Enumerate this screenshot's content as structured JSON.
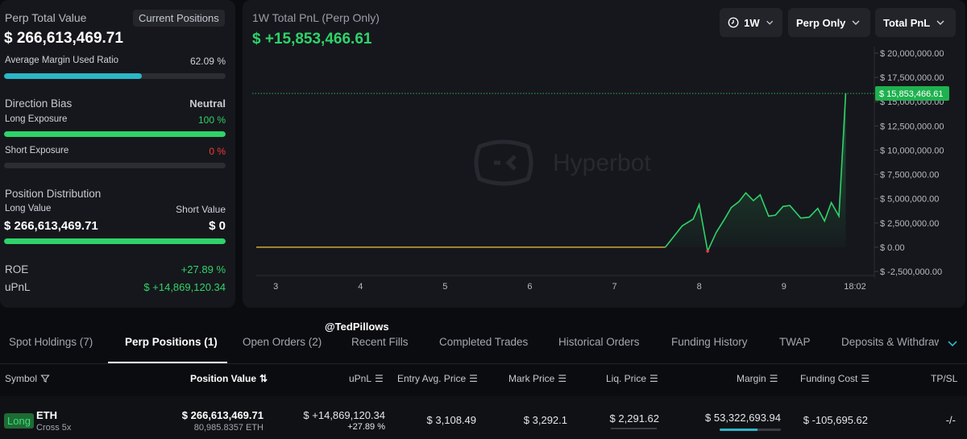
{
  "overview": {
    "title": "Perp Total Value",
    "current_positions_label": "Current Positions",
    "total_value": "$ 266,613,469.71",
    "avg_margin_label": "Average Margin Used Ratio",
    "avg_margin_value": "62.09 %",
    "avg_margin_fraction": 0.6209,
    "direction_bias_label": "Direction Bias",
    "direction_bias_value": "Neutral",
    "long_exposure_label": "Long Exposure",
    "long_exposure_value": "100 %",
    "long_exposure_fraction": 1.0,
    "short_exposure_label": "Short Exposure",
    "short_exposure_value": "0 %",
    "short_exposure_fraction": 0.0,
    "position_distribution_label": "Position Distribution",
    "long_value_label": "Long Value",
    "short_value_label": "Short Value",
    "long_value": "$ 266,613,469.71",
    "short_value": "$ 0",
    "long_distribution_fraction": 1.0,
    "roe_label": "ROE",
    "roe_value": "+27.89 %",
    "upnl_label": "uPnL",
    "upnl_value": "$ +14,869,120.34"
  },
  "chart_panel": {
    "title": "1W Total PnL (Perp Only)",
    "total_pnl": "$ +15,853,466.61",
    "timeframe": "1W",
    "scope": "Perp Only",
    "metric": "Total PnL",
    "watermark": "Hyperbot",
    "current_value_label": "$ 15,853,466.61"
  },
  "chart_data": {
    "type": "area",
    "y_ticks": [
      {
        "value": 20000000,
        "label": "$ 20,000,000.00"
      },
      {
        "value": 17500000,
        "label": "$ 17,500,000.00"
      },
      {
        "value": 15000000,
        "label": "$ 15,000,000.00"
      },
      {
        "value": 12500000,
        "label": "$ 12,500,000.00"
      },
      {
        "value": 10000000,
        "label": "$ 10,000,000.00"
      },
      {
        "value": 7500000,
        "label": "$ 7,500,000.00"
      },
      {
        "value": 5000000,
        "label": "$ 5,000,000.00"
      },
      {
        "value": 2500000,
        "label": "$ 2,500,000.00"
      },
      {
        "value": 0,
        "label": "$ 0.00"
      },
      {
        "value": -2500000,
        "label": "$ -2,500,000.00"
      }
    ],
    "ylim": [
      -2500000,
      20000000
    ],
    "x_ticks": [
      {
        "value": 3,
        "label": "3"
      },
      {
        "value": 4,
        "label": "4"
      },
      {
        "value": 5,
        "label": "5"
      },
      {
        "value": 6,
        "label": "6"
      },
      {
        "value": 7,
        "label": "7"
      },
      {
        "value": 8,
        "label": "8"
      },
      {
        "value": 9,
        "label": "9"
      },
      {
        "value": 9.84,
        "label": "18:02"
      }
    ],
    "xlim": [
      2.77,
      10.03
    ],
    "series": [
      {
        "x": [
          2.77,
          3.0,
          4.0,
          5.0,
          6.0,
          7.0,
          7.6,
          7.8,
          7.93,
          8.0,
          8.1,
          8.2,
          8.3,
          8.38,
          8.47,
          8.55,
          8.64,
          8.72,
          8.82,
          8.9,
          8.99,
          9.07,
          9.2,
          9.3,
          9.4,
          9.48,
          9.56,
          9.65,
          9.73,
          9.82,
          9.87,
          9.92,
          10.03
        ],
        "y": [
          0,
          0,
          0,
          0,
          0,
          0,
          0,
          2200000,
          2900000,
          4400000,
          -400000,
          1500000,
          2900000,
          4100000,
          4700000,
          5600000,
          4800000,
          5400000,
          3200000,
          3300000,
          4200000,
          4300000,
          3000000,
          3100000,
          4000000,
          2700000,
          4600000,
          3200000,
          15853466.61,
          15853466.61,
          15853466.61,
          15853466.61,
          15853466.61
        ]
      }
    ],
    "current_value": 15853466.61,
    "line_color": "#2fd36a",
    "flat_line_color": "#c9a83c",
    "dip_color": "#f23b3b",
    "grid": false
  },
  "watermark_handle": "@TedPillows",
  "tabs": [
    {
      "label": "Spot Holdings (7)",
      "active": false
    },
    {
      "label": "Perp Positions (1)",
      "active": true
    },
    {
      "label": "Open Orders (2)",
      "active": false
    },
    {
      "label": "Recent Fills",
      "active": false
    },
    {
      "label": "Completed Trades",
      "active": false
    },
    {
      "label": "Historical Orders",
      "active": false
    },
    {
      "label": "Funding History",
      "active": false
    },
    {
      "label": "TWAP",
      "active": false
    },
    {
      "label": "Deposits & Withdraw",
      "active": false
    }
  ],
  "table": {
    "headers": {
      "symbol": "Symbol",
      "position_value": "Position Value",
      "upnl": "uPnL",
      "entry": "Entry Avg. Price",
      "mark": "Mark Price",
      "liq": "Liq. Price",
      "margin": "Margin",
      "funding": "Funding Cost",
      "tpsl": "TP/SL"
    },
    "row": {
      "side": "Long",
      "symbol": "ETH",
      "mode": "Cross 5x",
      "position_value": "$ 266,613,469.71",
      "position_size": "80,985.8357 ETH",
      "upnl": "$ +14,869,120.34",
      "upnl_pct": "+27.89 %",
      "entry": "$ 3,108.49",
      "mark": "$ 3,292.1",
      "liq": "$ 2,291.62",
      "margin": "$ 53,322,693.94",
      "margin_ratio_fraction": 0.62,
      "funding": "$ -105,695.62",
      "tpsl": "-/-"
    }
  },
  "colors": {
    "green": "#2fd36a",
    "red": "#f23b3b",
    "teal": "#2bb6c8",
    "panel": "#16171c",
    "background": "#0b0c0f"
  }
}
